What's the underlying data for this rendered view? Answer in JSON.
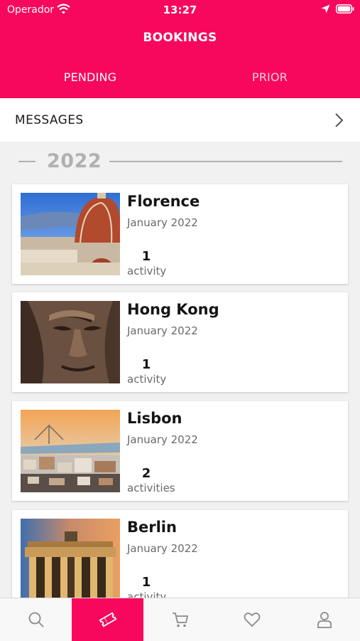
{
  "status_bar": {
    "carrier": "Operador",
    "time": "13:27"
  },
  "header": {
    "title": "BOOKINGS",
    "tabs": [
      {
        "label": "PENDING",
        "active": true
      },
      {
        "label": "PRIOR",
        "active": false
      }
    ]
  },
  "messages": {
    "label": "MESSAGES"
  },
  "year_section": {
    "year": "2022"
  },
  "bookings": [
    {
      "city": "Florence",
      "date": "January 2022",
      "count": "1",
      "unit": "activity"
    },
    {
      "city": "Hong Kong",
      "date": "January 2022",
      "count": "1",
      "unit": "activity"
    },
    {
      "city": "Lisbon",
      "date": "January 2022",
      "count": "2",
      "unit": "activities"
    },
    {
      "city": "Berlin",
      "date": "January 2022",
      "count": "1",
      "unit": "activity"
    }
  ],
  "bottom_nav": {
    "active_index": 1,
    "items": [
      {
        "icon": "search-icon"
      },
      {
        "icon": "ticket-icon"
      },
      {
        "icon": "cart-icon"
      },
      {
        "icon": "heart-icon"
      },
      {
        "icon": "profile-icon"
      }
    ]
  },
  "colors": {
    "brand": "#f7085c",
    "year_gray": "#b1b1b1",
    "secondary_text": "#6a6a6a"
  }
}
